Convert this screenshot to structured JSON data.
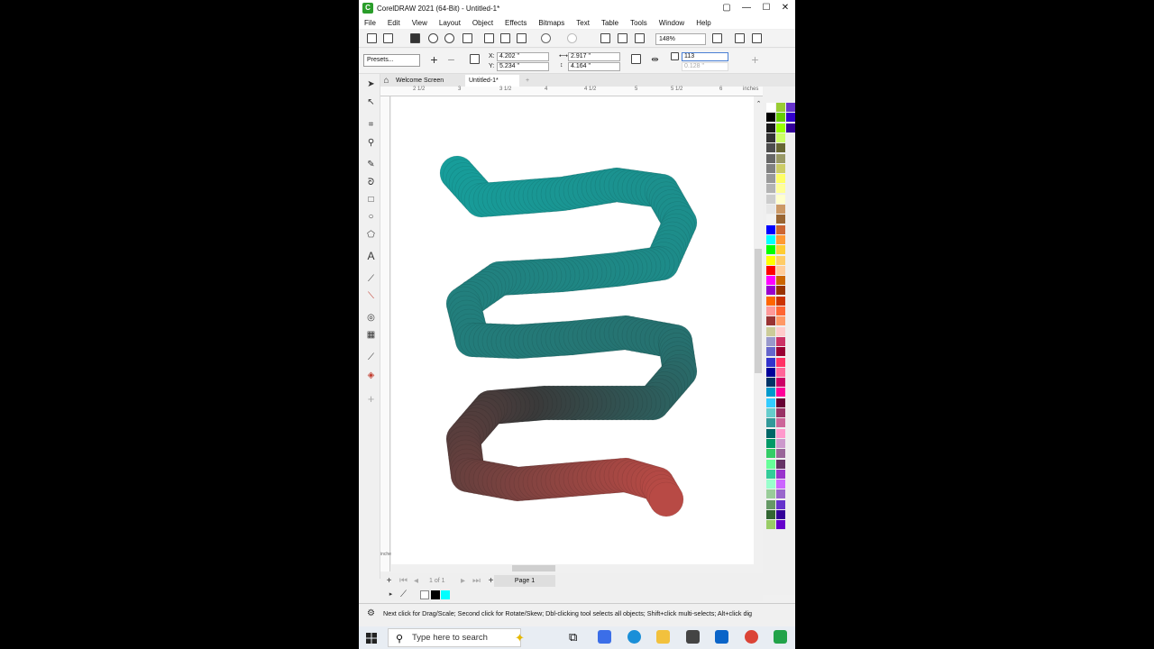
{
  "window": {
    "title": "CorelDRAW 2021 (64-Bit) - Untitled-1*",
    "controls": [
      "▢",
      "—",
      "☐",
      "✕"
    ]
  },
  "menu": [
    "File",
    "Edit",
    "View",
    "Layout",
    "Object",
    "Effects",
    "Bitmaps",
    "Text",
    "Table",
    "Tools",
    "Window",
    "Help"
  ],
  "standard_toolbar": {
    "zoom": "148%"
  },
  "property_bar": {
    "presets": "Presets...",
    "x_label": "X:",
    "x": "4.202 \"",
    "y_label": "Y:",
    "y": "5.234 \"",
    "width": "2.917 \"",
    "height": "4.164 \"",
    "steps": "113",
    "spacing": "0.128 \""
  },
  "tabs": {
    "welcome": "Welcome Screen",
    "doc": "Untitled-1*",
    "add": "+"
  },
  "ruler": {
    "units": "inches",
    "h_ticks": [
      "2 1/2",
      "3",
      "3 1/2",
      "4",
      "4 1/2",
      "5",
      "5 1/2",
      "6"
    ],
    "v_units": "inches"
  },
  "page_nav": {
    "page_of": "1 of 1",
    "page_tab": "Page 1"
  },
  "status": "Next click for Drag/Scale; Second click for Rotate/Skew; Dbl-clicking tool selects all objects; Shift+click multi-selects; Alt+click dig",
  "taskbar": {
    "search_placeholder": "Type here to search"
  },
  "colors": {
    "blend_start": "#179d9a",
    "blend_mid": "#3a3a3a",
    "blend_end": "#b84a45",
    "fill": "#000000",
    "outline": "#00ffff"
  }
}
